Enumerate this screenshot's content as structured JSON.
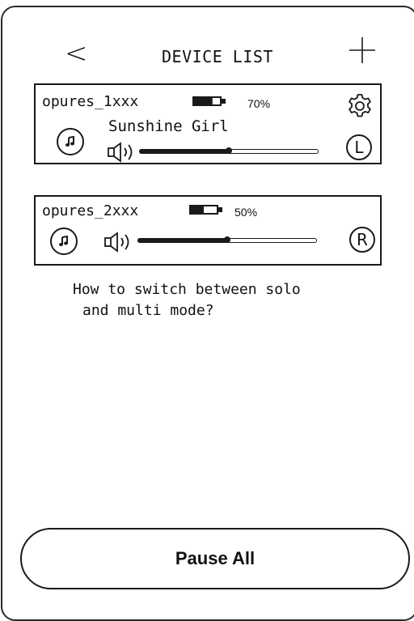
{
  "header": {
    "back_label": "<",
    "title": "DEVICE LIST"
  },
  "devices": [
    {
      "name": "opures_1xxx",
      "battery_pct_label": "70%",
      "battery_level": 0.7,
      "now_playing": "Sunshine Girl",
      "volume_level": 0.5,
      "channel": "L",
      "has_settings": true
    },
    {
      "name": "opures_2xxx",
      "battery_pct_label": "50%",
      "battery_level": 0.5,
      "now_playing": "",
      "volume_level": 0.5,
      "channel": "R",
      "has_settings": false
    }
  ],
  "help": {
    "line1": "How to switch between solo",
    "line2": "and multi mode?"
  },
  "footer": {
    "pause_all_label": "Pause All"
  },
  "icons": {
    "back": "chevron-left-icon",
    "add": "plus-icon",
    "settings": "gear-icon",
    "music": "music-note-icon",
    "volume": "speaker-icon",
    "battery": "battery-icon"
  }
}
